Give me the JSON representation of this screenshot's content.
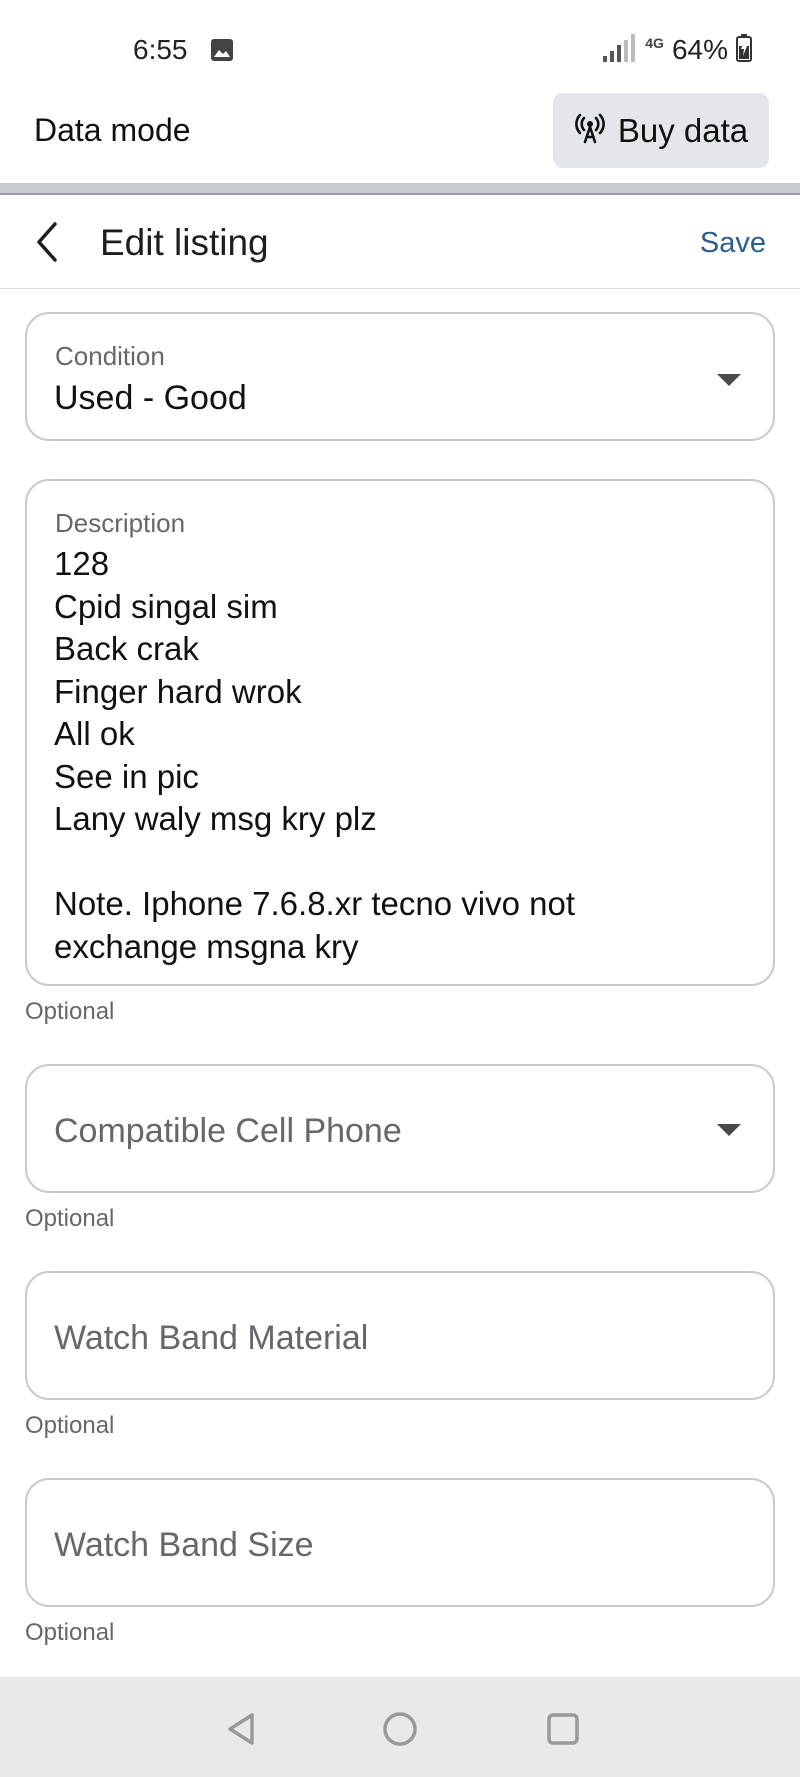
{
  "status_bar": {
    "time": "6:55",
    "network_type": "4G",
    "battery": "64%",
    "icons": [
      "gallery-icon",
      "signal-icon",
      "battery-charging-icon"
    ]
  },
  "data_mode": {
    "label": "Data mode",
    "buy_button": "Buy data",
    "buy_icon": "antenna-icon"
  },
  "header": {
    "title": "Edit listing",
    "save_label": "Save",
    "back_icon": "chevron-left-icon"
  },
  "fields": {
    "condition": {
      "label": "Condition",
      "value": "Used - Good",
      "helper": ""
    },
    "description": {
      "label": "Description",
      "lines": [
        "128",
        "Cpid singal sim",
        "Back crak",
        "Finger hard wrok",
        "All ok",
        "See in pic",
        "Lany waly msg kry plz",
        "",
        "Note. Iphone 7.6.8.xr tecno vivo not",
        "exchange msgna kry"
      ],
      "helper": "Optional"
    },
    "compatible_cell_phone": {
      "placeholder": "Compatible Cell Phone",
      "helper": "Optional"
    },
    "watch_band_material": {
      "placeholder": "Watch Band Material",
      "helper": "Optional"
    },
    "watch_band_size": {
      "placeholder": "Watch Band Size",
      "helper": "Optional"
    }
  },
  "nav_bar": {
    "buttons": [
      "back-triangle-icon",
      "home-circle-icon",
      "recents-square-icon"
    ]
  },
  "colors": {
    "accent": "#2b5e8e",
    "field_border": "#c8cacd",
    "button_bg": "#e4e6eb",
    "nav_bg": "#e9e9e9"
  }
}
